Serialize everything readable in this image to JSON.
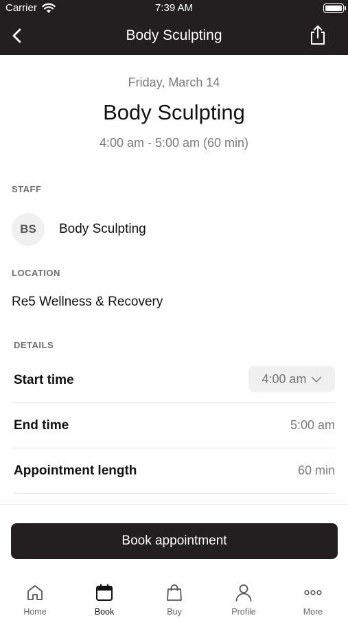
{
  "status_bar": {
    "carrier": "Carrier",
    "time": "7:39 AM"
  },
  "nav": {
    "title": "Body Sculpting"
  },
  "appointment": {
    "date": "Friday, March 14",
    "title": "Body Sculpting",
    "time_range": "4:00 am - 5:00 am (60 min)"
  },
  "staff": {
    "section_label": "STAFF",
    "initials": "BS",
    "name": "Body Sculpting"
  },
  "location": {
    "section_label": "LOCATION",
    "name": "Re5 Wellness & Recovery"
  },
  "details": {
    "section_label": "DETAILS",
    "start_time_label": "Start time",
    "start_time_value": "4:00 am",
    "end_time_label": "End time",
    "end_time_value": "5:00 am",
    "length_label": "Appointment length",
    "length_value": "60 min"
  },
  "book_button": {
    "label": "Book appointment"
  },
  "tabs": [
    {
      "label": "Home",
      "icon": "home-icon"
    },
    {
      "label": "Book",
      "icon": "calendar-icon"
    },
    {
      "label": "Buy",
      "icon": "shopping-bag-icon"
    },
    {
      "label": "Profile",
      "icon": "person-icon"
    },
    {
      "label": "More",
      "icon": "more-dots-icon"
    }
  ],
  "active_tab": "Book",
  "colors": {
    "header_bg": "#231f20",
    "button_bg": "#231f20",
    "muted_text": "#7a7a7a"
  }
}
